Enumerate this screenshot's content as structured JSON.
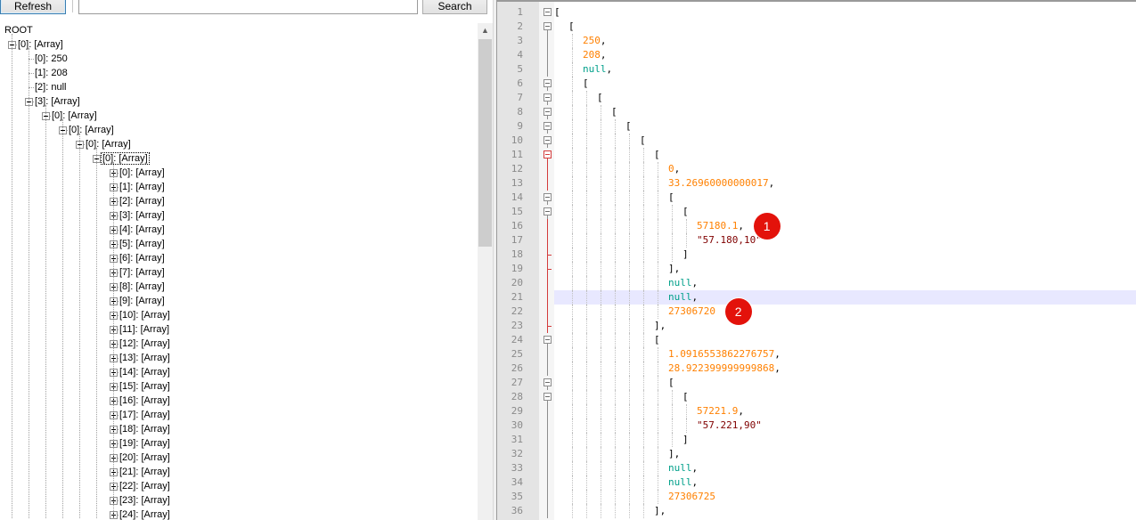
{
  "toolbar": {
    "refresh_label": "Refresh",
    "search_value": "",
    "search_label": "Search"
  },
  "tree": {
    "root_label": "ROOT",
    "nodes": [
      {
        "label": "[0]: [Array]",
        "depth": 0,
        "expander": "minus"
      },
      {
        "label": "[0]: 250",
        "depth": 1,
        "expander": "none"
      },
      {
        "label": "[1]: 208",
        "depth": 1,
        "expander": "none"
      },
      {
        "label": "[2]: null",
        "depth": 1,
        "expander": "none"
      },
      {
        "label": "[3]: [Array]",
        "depth": 1,
        "expander": "minus"
      },
      {
        "label": "[0]: [Array]",
        "depth": 2,
        "expander": "minus"
      },
      {
        "label": "[0]: [Array]",
        "depth": 3,
        "expander": "minus"
      },
      {
        "label": "[0]: [Array]",
        "depth": 4,
        "expander": "minus"
      },
      {
        "label": "[0]: [Array]",
        "depth": 5,
        "expander": "minus",
        "selected": true
      },
      {
        "label": "[0]: [Array]",
        "depth": 6,
        "expander": "plus"
      },
      {
        "label": "[1]: [Array]",
        "depth": 6,
        "expander": "plus"
      },
      {
        "label": "[2]: [Array]",
        "depth": 6,
        "expander": "plus"
      },
      {
        "label": "[3]: [Array]",
        "depth": 6,
        "expander": "plus"
      },
      {
        "label": "[4]: [Array]",
        "depth": 6,
        "expander": "plus"
      },
      {
        "label": "[5]: [Array]",
        "depth": 6,
        "expander": "plus"
      },
      {
        "label": "[6]: [Array]",
        "depth": 6,
        "expander": "plus"
      },
      {
        "label": "[7]: [Array]",
        "depth": 6,
        "expander": "plus"
      },
      {
        "label": "[8]: [Array]",
        "depth": 6,
        "expander": "plus"
      },
      {
        "label": "[9]: [Array]",
        "depth": 6,
        "expander": "plus"
      },
      {
        "label": "[10]: [Array]",
        "depth": 6,
        "expander": "plus"
      },
      {
        "label": "[11]: [Array]",
        "depth": 6,
        "expander": "plus"
      },
      {
        "label": "[12]: [Array]",
        "depth": 6,
        "expander": "plus"
      },
      {
        "label": "[13]: [Array]",
        "depth": 6,
        "expander": "plus"
      },
      {
        "label": "[14]: [Array]",
        "depth": 6,
        "expander": "plus"
      },
      {
        "label": "[15]: [Array]",
        "depth": 6,
        "expander": "plus"
      },
      {
        "label": "[16]: [Array]",
        "depth": 6,
        "expander": "plus"
      },
      {
        "label": "[17]: [Array]",
        "depth": 6,
        "expander": "plus"
      },
      {
        "label": "[18]: [Array]",
        "depth": 6,
        "expander": "plus"
      },
      {
        "label": "[19]: [Array]",
        "depth": 6,
        "expander": "plus"
      },
      {
        "label": "[20]: [Array]",
        "depth": 6,
        "expander": "plus"
      },
      {
        "label": "[21]: [Array]",
        "depth": 6,
        "expander": "plus"
      },
      {
        "label": "[22]: [Array]",
        "depth": 6,
        "expander": "plus"
      },
      {
        "label": "[23]: [Array]",
        "depth": 6,
        "expander": "plus"
      },
      {
        "label": "[24]: [Array]",
        "depth": 6,
        "expander": "plus"
      }
    ]
  },
  "editor": {
    "highlighted_line": 21,
    "lines": [
      {
        "n": "1",
        "indent": 0,
        "tokens": [
          {
            "t": "[",
            "c": "punc"
          }
        ],
        "fold": "box"
      },
      {
        "n": "2",
        "indent": 1,
        "tokens": [
          {
            "t": "[",
            "c": "punc"
          }
        ],
        "fold": "box"
      },
      {
        "n": "3",
        "indent": 2,
        "tokens": [
          {
            "t": "250",
            "c": "num"
          },
          {
            "t": ",",
            "c": "punc"
          }
        ],
        "fold": "line"
      },
      {
        "n": "4",
        "indent": 2,
        "tokens": [
          {
            "t": "208",
            "c": "num"
          },
          {
            "t": ",",
            "c": "punc"
          }
        ],
        "fold": "line"
      },
      {
        "n": "5",
        "indent": 2,
        "tokens": [
          {
            "t": "null",
            "c": "null"
          },
          {
            "t": ",",
            "c": "punc"
          }
        ],
        "fold": "line"
      },
      {
        "n": "6",
        "indent": 2,
        "tokens": [
          {
            "t": "[",
            "c": "punc"
          }
        ],
        "fold": "box"
      },
      {
        "n": "7",
        "indent": 3,
        "tokens": [
          {
            "t": "[",
            "c": "punc"
          }
        ],
        "fold": "box"
      },
      {
        "n": "8",
        "indent": 4,
        "tokens": [
          {
            "t": "[",
            "c": "punc"
          }
        ],
        "fold": "box"
      },
      {
        "n": "9",
        "indent": 5,
        "tokens": [
          {
            "t": "[",
            "c": "punc"
          }
        ],
        "fold": "box"
      },
      {
        "n": "10",
        "indent": 6,
        "tokens": [
          {
            "t": "[",
            "c": "punc"
          }
        ],
        "fold": "box"
      },
      {
        "n": "11",
        "indent": 7,
        "tokens": [
          {
            "t": "[",
            "c": "punc"
          }
        ],
        "fold": "redbox"
      },
      {
        "n": "12",
        "indent": 8,
        "tokens": [
          {
            "t": "0",
            "c": "num"
          },
          {
            "t": ",",
            "c": "punc"
          }
        ],
        "fold": "red"
      },
      {
        "n": "13",
        "indent": 8,
        "tokens": [
          {
            "t": "33.26960000000017",
            "c": "num"
          },
          {
            "t": ",",
            "c": "punc"
          }
        ],
        "fold": "red"
      },
      {
        "n": "14",
        "indent": 8,
        "tokens": [
          {
            "t": "[",
            "c": "punc"
          }
        ],
        "fold": "box"
      },
      {
        "n": "15",
        "indent": 9,
        "tokens": [
          {
            "t": "[",
            "c": "punc"
          }
        ],
        "fold": "box"
      },
      {
        "n": "16",
        "indent": 10,
        "tokens": [
          {
            "t": "57180.1",
            "c": "num"
          },
          {
            "t": ",",
            "c": "punc"
          }
        ],
        "fold": "red"
      },
      {
        "n": "17",
        "indent": 10,
        "tokens": [
          {
            "t": "\"57.180,10\"",
            "c": "str"
          }
        ],
        "fold": "red"
      },
      {
        "n": "18",
        "indent": 9,
        "tokens": [
          {
            "t": "]",
            "c": "punc"
          }
        ],
        "fold": "redtick"
      },
      {
        "n": "19",
        "indent": 8,
        "tokens": [
          {
            "t": "],",
            "c": "punc"
          }
        ],
        "fold": "redtick"
      },
      {
        "n": "20",
        "indent": 8,
        "tokens": [
          {
            "t": "null",
            "c": "null"
          },
          {
            "t": ",",
            "c": "punc"
          }
        ],
        "fold": "red"
      },
      {
        "n": "21",
        "indent": 8,
        "tokens": [
          {
            "t": "null",
            "c": "null"
          },
          {
            "t": ",",
            "c": "punc"
          }
        ],
        "fold": "red"
      },
      {
        "n": "22",
        "indent": 8,
        "tokens": [
          {
            "t": "27306720",
            "c": "num"
          }
        ],
        "fold": "red"
      },
      {
        "n": "23",
        "indent": 7,
        "tokens": [
          {
            "t": "],",
            "c": "punc"
          }
        ],
        "fold": "redtick"
      },
      {
        "n": "24",
        "indent": 7,
        "tokens": [
          {
            "t": "[",
            "c": "punc"
          }
        ],
        "fold": "box"
      },
      {
        "n": "25",
        "indent": 8,
        "tokens": [
          {
            "t": "1.0916553862276757",
            "c": "num"
          },
          {
            "t": ",",
            "c": "punc"
          }
        ],
        "fold": "line"
      },
      {
        "n": "26",
        "indent": 8,
        "tokens": [
          {
            "t": "28.922399999999868",
            "c": "num"
          },
          {
            "t": ",",
            "c": "punc"
          }
        ],
        "fold": "line"
      },
      {
        "n": "27",
        "indent": 8,
        "tokens": [
          {
            "t": "[",
            "c": "punc"
          }
        ],
        "fold": "box"
      },
      {
        "n": "28",
        "indent": 9,
        "tokens": [
          {
            "t": "[",
            "c": "punc"
          }
        ],
        "fold": "box"
      },
      {
        "n": "29",
        "indent": 10,
        "tokens": [
          {
            "t": "57221.9",
            "c": "num"
          },
          {
            "t": ",",
            "c": "punc"
          }
        ],
        "fold": "line"
      },
      {
        "n": "30",
        "indent": 10,
        "tokens": [
          {
            "t": "\"57.221,90\"",
            "c": "str"
          }
        ],
        "fold": "line"
      },
      {
        "n": "31",
        "indent": 9,
        "tokens": [
          {
            "t": "]",
            "c": "punc"
          }
        ],
        "fold": "line"
      },
      {
        "n": "32",
        "indent": 8,
        "tokens": [
          {
            "t": "],",
            "c": "punc"
          }
        ],
        "fold": "line"
      },
      {
        "n": "33",
        "indent": 8,
        "tokens": [
          {
            "t": "null",
            "c": "null"
          },
          {
            "t": ",",
            "c": "punc"
          }
        ],
        "fold": "line"
      },
      {
        "n": "34",
        "indent": 8,
        "tokens": [
          {
            "t": "null",
            "c": "null"
          },
          {
            "t": ",",
            "c": "punc"
          }
        ],
        "fold": "line"
      },
      {
        "n": "35",
        "indent": 8,
        "tokens": [
          {
            "t": "27306725",
            "c": "num"
          }
        ],
        "fold": "line"
      },
      {
        "n": "36",
        "indent": 7,
        "tokens": [
          {
            "t": "],",
            "c": "punc"
          }
        ],
        "fold": "line"
      }
    ]
  },
  "markers": [
    {
      "label": "1",
      "line": 16
    },
    {
      "label": "2",
      "line": 22
    }
  ],
  "colors": {
    "number": "#ff8000",
    "null": "#00a08a",
    "string": "#800000",
    "marker": "#e3120b",
    "fold_active": "#d43c3c",
    "highlight_line": "#e8e8ff"
  }
}
